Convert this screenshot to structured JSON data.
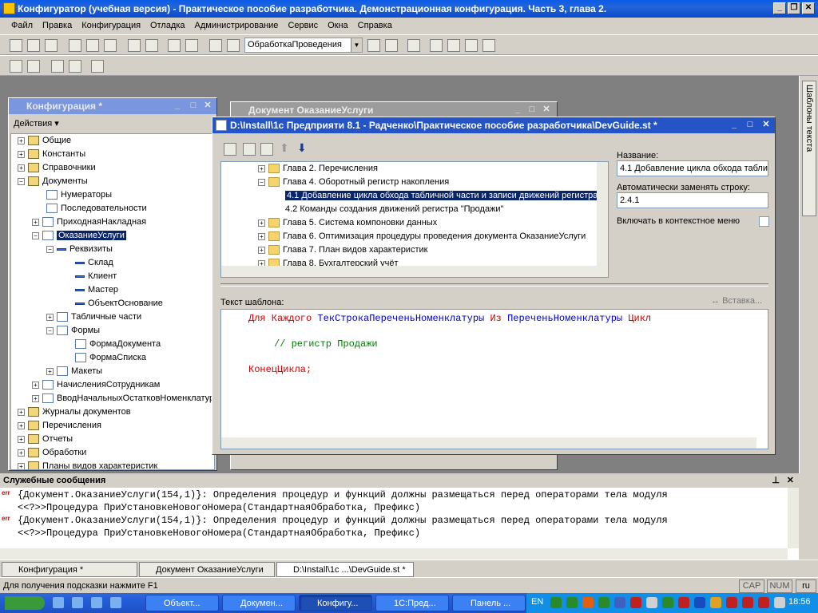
{
  "app": {
    "title": "Конфигуратор (учебная версия) - Практическое пособие разработчика. Демонстрационная конфигурация. Часть 3, глава 2."
  },
  "menu": [
    "Файл",
    "Правка",
    "Конфигурация",
    "Отладка",
    "Администрирование",
    "Сервис",
    "Окна",
    "Справка"
  ],
  "toolbar": {
    "combo_value": "ОбработкаПроведения"
  },
  "config_panel": {
    "title": "Конфигурация *",
    "actions_label": "Действия",
    "tree": [
      {
        "label": "Общие"
      },
      {
        "label": "Константы"
      },
      {
        "label": "Справочники"
      },
      {
        "label": "Документы"
      },
      {
        "label": "Нумераторы"
      },
      {
        "label": "Последовательности"
      },
      {
        "label": "ПриходнаяНакладная"
      },
      {
        "label": "ОказаниеУслуги"
      },
      {
        "label": "Реквизиты"
      },
      {
        "label": "Склад"
      },
      {
        "label": "Клиент"
      },
      {
        "label": "Мастер"
      },
      {
        "label": "ОбъектОснование"
      },
      {
        "label": "Табличные части"
      },
      {
        "label": "Формы"
      },
      {
        "label": "ФормаДокумента"
      },
      {
        "label": "ФормаСписка"
      },
      {
        "label": "Макеты"
      },
      {
        "label": "НачисленияСотрудникам"
      },
      {
        "label": "ВводНачальныхОстатковНоменклатуры"
      },
      {
        "label": "Журналы документов"
      },
      {
        "label": "Перечисления"
      },
      {
        "label": "Отчеты"
      },
      {
        "label": "Обработки"
      },
      {
        "label": "Планы видов характеристик"
      }
    ]
  },
  "doc_window": {
    "title": "Документ ОказаниеУслуги"
  },
  "guide_window": {
    "title": "D:\\Install\\1с Предприяти 8.1 - Радченко\\Практическое пособие разработчика\\DevGuide.st *",
    "tree": [
      {
        "label": "Глава 2. Перечисления"
      },
      {
        "label": "Глава 4. Оборотный регистр накопления"
      },
      {
        "label": "4.1 Добавление цикла обхода табличной части и записи движений регистра"
      },
      {
        "label": "4.2 Команды создания движений регистра \"Продажи\""
      },
      {
        "label": "Глава 5. Система компоновки данных"
      },
      {
        "label": "Глава 6. Оптимизация процедуры проведения документа ОказаниеУслуги"
      },
      {
        "label": "Глава 7. План видов характеристик"
      },
      {
        "label": "Глава 8. Бухгалтерский учёт"
      }
    ],
    "name_label": "Название:",
    "name_value": "4.1 Добавление цикла обхода табли",
    "auto_label": "Автоматически заменять строку:",
    "auto_value": "2.4.1",
    "context_label": "Включать в контекстное меню",
    "template_label": "Текст шаблона:",
    "insert_label": "Вставка...",
    "code": {
      "kw1": "Для Каждого",
      "var1": "ТекСтрокаПереченьНоменклатуры",
      "kw2": "Из",
      "var2": "ПереченьНоменклатуры",
      "kw3": "Цикл",
      "comment": "// регистр Продажи",
      "end": "КонецЦикла;"
    }
  },
  "rail": {
    "label": "Шаблоны текста"
  },
  "messages": {
    "title": "Служебные сообщения",
    "lines": [
      {
        "badge": "err",
        "text": "{Документ.ОказаниеУслуги(154,1)}: Определения процедур и функций должны размещаться перед операторами тела модуля"
      },
      {
        "badge": "",
        "text": "<<?>>Процедура ПриУстановкеНовогоНомера(СтандартнаяОбработка, Префикс)"
      },
      {
        "badge": "err",
        "text": "{Документ.ОказаниеУслуги(154,1)}: Определения процедур и функций должны размещаться перед операторами тела модуля"
      },
      {
        "badge": "",
        "text": "<<?>>Процедура ПриУстановкеНовогоНомера(СтандартнаяОбработка, Префикс)"
      }
    ]
  },
  "window_tabs": [
    "Конфигурация *",
    "Документ ОказаниеУслуги",
    "D:\\Install\\1с ...\\DevGuide.st *"
  ],
  "status": {
    "hint": "Для получения подсказки нажмите F1",
    "cap": "CAP",
    "num": "NUM",
    "lang": "ru"
  },
  "taskbar": {
    "tasks": [
      "Объект...",
      "Докумен...",
      "Конфигу...",
      "1С:Пред...",
      "Панель ..."
    ],
    "lang": "EN",
    "clock": "18:56"
  },
  "colors": {
    "title_active": "#2454c6",
    "selection": "#0a246a",
    "keyword": "#cc0000",
    "identifier": "#0000cc",
    "comment": "#008000"
  }
}
